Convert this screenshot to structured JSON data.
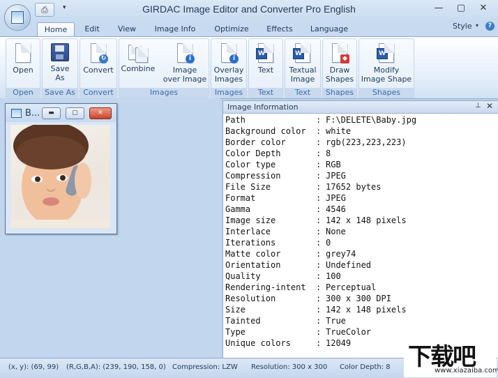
{
  "window": {
    "title": "GIRDAC Image Editor and Converter Pro English",
    "minimize_glyph": "—",
    "maximize_glyph": "▢",
    "close_glyph": "✕"
  },
  "qat": {
    "print_icon": "print-icon",
    "dropdown_glyph": "▾"
  },
  "tabs": [
    {
      "label": "Home",
      "active": true
    },
    {
      "label": "Edit"
    },
    {
      "label": "View"
    },
    {
      "label": "Image Info"
    },
    {
      "label": "Optimize"
    },
    {
      "label": "Effects"
    },
    {
      "label": "Language"
    }
  ],
  "style_menu": {
    "label": "Style",
    "dropdown_glyph": "▾",
    "help_glyph": "?"
  },
  "ribbon": {
    "groups": [
      {
        "label": "Open",
        "buttons": [
          {
            "label": "Open"
          }
        ]
      },
      {
        "label": "Save As",
        "buttons": [
          {
            "label": "Save\nAs"
          }
        ]
      },
      {
        "label": "Convert",
        "buttons": [
          {
            "label": "Convert"
          }
        ]
      },
      {
        "label": "Images",
        "buttons": [
          {
            "label": "Combine"
          },
          {
            "label": "Image\nover Image"
          }
        ]
      },
      {
        "label": "Images",
        "buttons": [
          {
            "label": "Overlay\nImages"
          }
        ]
      },
      {
        "label": "Text",
        "buttons": [
          {
            "label": "Text"
          }
        ]
      },
      {
        "label": "Text",
        "buttons": [
          {
            "label": "Textual\nImage"
          }
        ]
      },
      {
        "label": "Shapes",
        "buttons": [
          {
            "label": "Draw\nShapes"
          }
        ]
      },
      {
        "label": "Shapes",
        "buttons": [
          {
            "label": "Modify\nImage Shape"
          }
        ]
      }
    ],
    "badge_info_glyph": "i",
    "word_glyph": "W"
  },
  "child_window": {
    "title": "B...",
    "min_glyph": "▬",
    "max_glyph": "▢",
    "close_glyph": "✕"
  },
  "info_panel": {
    "title": "Image Information",
    "pin_glyph": "⊥",
    "close_glyph": "✕",
    "rows": [
      {
        "key": "Path",
        "value": "F:\\DELETE\\Baby.jpg"
      },
      {
        "key": "Background color",
        "value": "white"
      },
      {
        "key": "Border color",
        "value": "rgb(223,223,223)"
      },
      {
        "key": "Color Depth",
        "value": "8"
      },
      {
        "key": "Color type",
        "value": "RGB"
      },
      {
        "key": "Compression",
        "value": "JPEG"
      },
      {
        "key": "File Size",
        "value": "17652 bytes"
      },
      {
        "key": "Format",
        "value": "JPEG"
      },
      {
        "key": "Gamma",
        "value": "4546"
      },
      {
        "key": "Image size",
        "value": "142 x 148 pixels"
      },
      {
        "key": "Interlace",
        "value": "None"
      },
      {
        "key": "Iterations",
        "value": "0"
      },
      {
        "key": "Matte color",
        "value": "grey74"
      },
      {
        "key": "Orientation",
        "value": "Undefined"
      },
      {
        "key": "Quality",
        "value": "100"
      },
      {
        "key": "Rendering-intent",
        "value": "Perceptual"
      },
      {
        "key": "Resolution",
        "value": "300 x 300 DPI"
      },
      {
        "key": "Size",
        "value": "142 x 148 pixels"
      },
      {
        "key": "Tainted",
        "value": "True"
      },
      {
        "key": "Type",
        "value": "TrueColor"
      },
      {
        "key": "Unique colors",
        "value": "12049"
      }
    ],
    "colon": ":"
  },
  "status": {
    "xy": "(x, y): (69, 99)",
    "rgba": "(R,G,B,A): (239, 190, 158, 0)",
    "compression": "Compression: LZW",
    "resolution": "Resolution: 300 x 300",
    "color_depth": "Color Depth: 8"
  },
  "watermark": {
    "big": "下载吧",
    "small": "www.xiazaiba.com"
  }
}
